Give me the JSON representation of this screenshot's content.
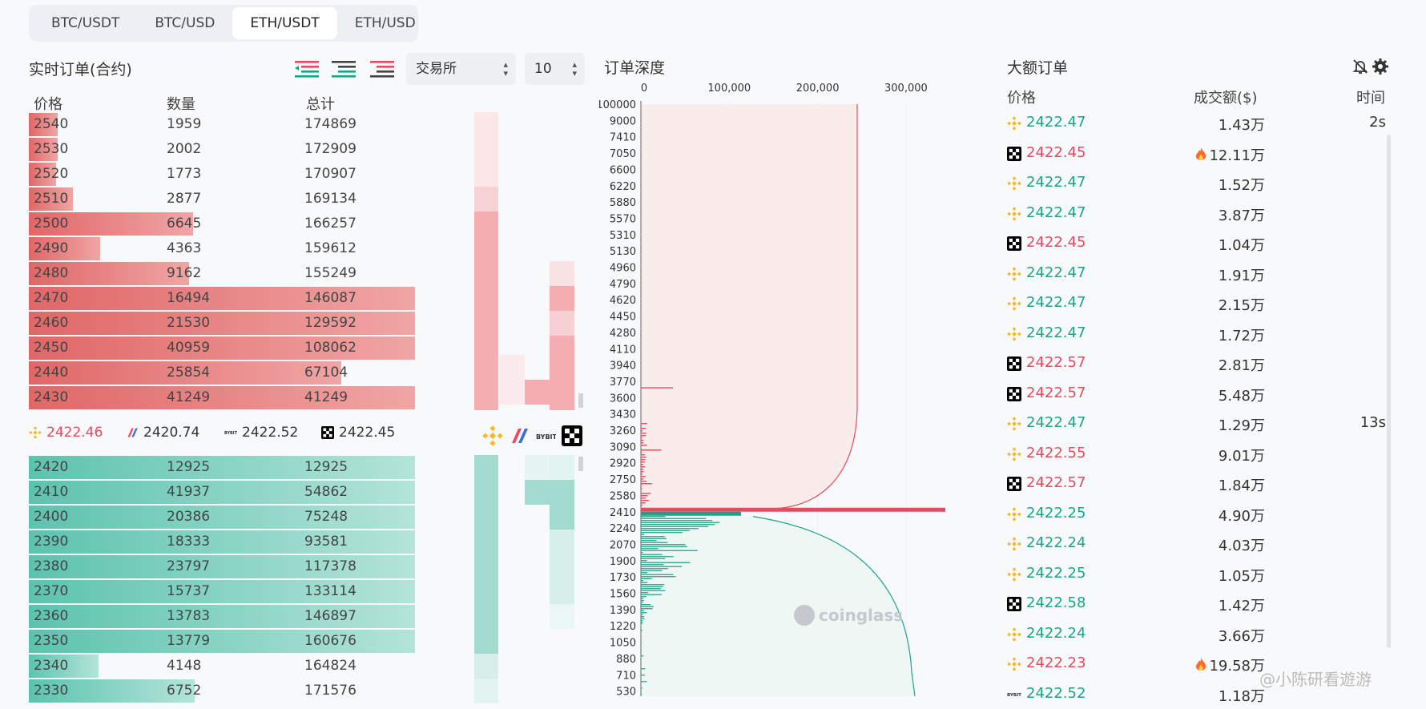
{
  "tabs": [
    {
      "label": "BTC/USDT",
      "active": false
    },
    {
      "label": "BTC/USD",
      "active": false
    },
    {
      "label": "ETH/USDT",
      "active": true
    },
    {
      "label": "ETH/USD",
      "active": false
    }
  ],
  "orderbook": {
    "title": "实时订单(合约)",
    "exchange_select": "交易所",
    "depth_select": "10",
    "columns": {
      "price": "价格",
      "qty": "数量",
      "total": "总计"
    },
    "asks": [
      {
        "price": "2540",
        "qty": "1959",
        "total": "174869",
        "w": 0.075
      },
      {
        "price": "2530",
        "qty": "2002",
        "total": "172909",
        "w": 0.075
      },
      {
        "price": "2520",
        "qty": "1773",
        "total": "170907",
        "w": 0.07
      },
      {
        "price": "2510",
        "qty": "2877",
        "total": "169134",
        "w": 0.115
      },
      {
        "price": "2500",
        "qty": "6645",
        "total": "166257",
        "w": 0.425
      },
      {
        "price": "2490",
        "qty": "4363",
        "total": "159612",
        "w": 0.185
      },
      {
        "price": "2480",
        "qty": "9162",
        "total": "155249",
        "w": 0.415
      },
      {
        "price": "2470",
        "qty": "16494",
        "total": "146087",
        "w": 1.0
      },
      {
        "price": "2460",
        "qty": "21530",
        "total": "129592",
        "w": 1.0
      },
      {
        "price": "2450",
        "qty": "40959",
        "total": "108062",
        "w": 1.0
      },
      {
        "price": "2440",
        "qty": "25854",
        "total": "67104",
        "w": 0.81
      },
      {
        "price": "2430",
        "qty": "41249",
        "total": "41249",
        "w": 1.0
      }
    ],
    "bids": [
      {
        "price": "2420",
        "qty": "12925",
        "total": "12925",
        "w": 1.0
      },
      {
        "price": "2410",
        "qty": "41937",
        "total": "54862",
        "w": 1.0
      },
      {
        "price": "2400",
        "qty": "20386",
        "total": "75248",
        "w": 1.0
      },
      {
        "price": "2390",
        "qty": "18333",
        "total": "93581",
        "w": 1.0
      },
      {
        "price": "2380",
        "qty": "23797",
        "total": "117378",
        "w": 1.0
      },
      {
        "price": "2370",
        "qty": "15737",
        "total": "133114",
        "w": 1.0
      },
      {
        "price": "2360",
        "qty": "13783",
        "total": "146897",
        "w": 1.0
      },
      {
        "price": "2350",
        "qty": "13779",
        "total": "160676",
        "w": 1.0
      },
      {
        "price": "2340",
        "qty": "4148",
        "total": "164824",
        "w": 0.18
      },
      {
        "price": "2330",
        "qty": "6752",
        "total": "171576",
        "w": 0.43
      }
    ],
    "mid_prices": [
      {
        "exchange": "binance-icon",
        "price": "2422.46",
        "color": "#e84a5f"
      },
      {
        "exchange": "bitmex-icon",
        "price": "2420.74",
        "color": "#333333"
      },
      {
        "exchange": "bybit-icon",
        "price": "2422.52",
        "color": "#333333"
      },
      {
        "exchange": "okx-icon",
        "price": "2422.45",
        "color": "#333333"
      }
    ]
  },
  "depth": {
    "title": "订单深度",
    "x_ticks": [
      "0",
      "100,000",
      "200,000",
      "300,000"
    ],
    "y_ticks": [
      "100000",
      "9000",
      "7410",
      "7050",
      "6600",
      "6220",
      "5880",
      "5570",
      "5310",
      "5130",
      "4960",
      "4790",
      "4620",
      "4450",
      "4280",
      "4110",
      "3940",
      "3770",
      "3600",
      "3430",
      "3260",
      "3090",
      "2920",
      "2750",
      "2580",
      "2410",
      "2240",
      "2070",
      "1900",
      "1730",
      "1560",
      "1390",
      "1220",
      "1050",
      "880",
      "710",
      "530"
    ],
    "watermark": "coinglass"
  },
  "large_orders": {
    "title": "大额订单",
    "columns": {
      "price": "价格",
      "amount": "成交额($)",
      "time": "时间"
    },
    "rows": [
      {
        "ex": "binance",
        "price": "2422.47",
        "side": "buy",
        "amount": "1.43万",
        "hot": false,
        "time": "2s"
      },
      {
        "ex": "okx",
        "price": "2422.45",
        "side": "sell",
        "amount": "12.11万",
        "hot": true,
        "time": ""
      },
      {
        "ex": "binance",
        "price": "2422.47",
        "side": "buy",
        "amount": "1.52万",
        "hot": false,
        "time": ""
      },
      {
        "ex": "binance",
        "price": "2422.47",
        "side": "buy",
        "amount": "3.87万",
        "hot": false,
        "time": ""
      },
      {
        "ex": "okx",
        "price": "2422.45",
        "side": "sell",
        "amount": "1.04万",
        "hot": false,
        "time": ""
      },
      {
        "ex": "binance",
        "price": "2422.47",
        "side": "buy",
        "amount": "1.91万",
        "hot": false,
        "time": ""
      },
      {
        "ex": "binance",
        "price": "2422.47",
        "side": "buy",
        "amount": "2.15万",
        "hot": false,
        "time": ""
      },
      {
        "ex": "binance",
        "price": "2422.47",
        "side": "buy",
        "amount": "1.72万",
        "hot": false,
        "time": ""
      },
      {
        "ex": "okx",
        "price": "2422.57",
        "side": "sell",
        "amount": "2.81万",
        "hot": false,
        "time": ""
      },
      {
        "ex": "okx",
        "price": "2422.57",
        "side": "sell",
        "amount": "5.48万",
        "hot": false,
        "time": ""
      },
      {
        "ex": "binance",
        "price": "2422.47",
        "side": "buy",
        "amount": "1.29万",
        "hot": false,
        "time": "13s"
      },
      {
        "ex": "binance",
        "price": "2422.55",
        "side": "sell",
        "amount": "9.01万",
        "hot": false,
        "time": ""
      },
      {
        "ex": "okx",
        "price": "2422.57",
        "side": "sell",
        "amount": "1.84万",
        "hot": false,
        "time": ""
      },
      {
        "ex": "binance",
        "price": "2422.25",
        "side": "buy",
        "amount": "4.90万",
        "hot": false,
        "time": ""
      },
      {
        "ex": "binance",
        "price": "2422.24",
        "side": "buy",
        "amount": "4.03万",
        "hot": false,
        "time": ""
      },
      {
        "ex": "binance",
        "price": "2422.25",
        "side": "buy",
        "amount": "1.05万",
        "hot": false,
        "time": ""
      },
      {
        "ex": "okx",
        "price": "2422.58",
        "side": "buy",
        "amount": "1.42万",
        "hot": false,
        "time": ""
      },
      {
        "ex": "binance",
        "price": "2422.24",
        "side": "buy",
        "amount": "3.66万",
        "hot": false,
        "time": ""
      },
      {
        "ex": "binance",
        "price": "2422.23",
        "side": "sell",
        "amount": "19.58万",
        "hot": true,
        "time": ""
      },
      {
        "ex": "bybit",
        "price": "2422.52",
        "side": "buy",
        "amount": "1.18万",
        "hot": false,
        "time": ""
      }
    ]
  },
  "watermark": "@小陈研看遊游",
  "colors": {
    "red": "#e84a5f",
    "green": "#1aa58a",
    "ask_bar": "#e06767",
    "bid_bar": "#5cc3ae",
    "binance": "#f3ba2f"
  }
}
